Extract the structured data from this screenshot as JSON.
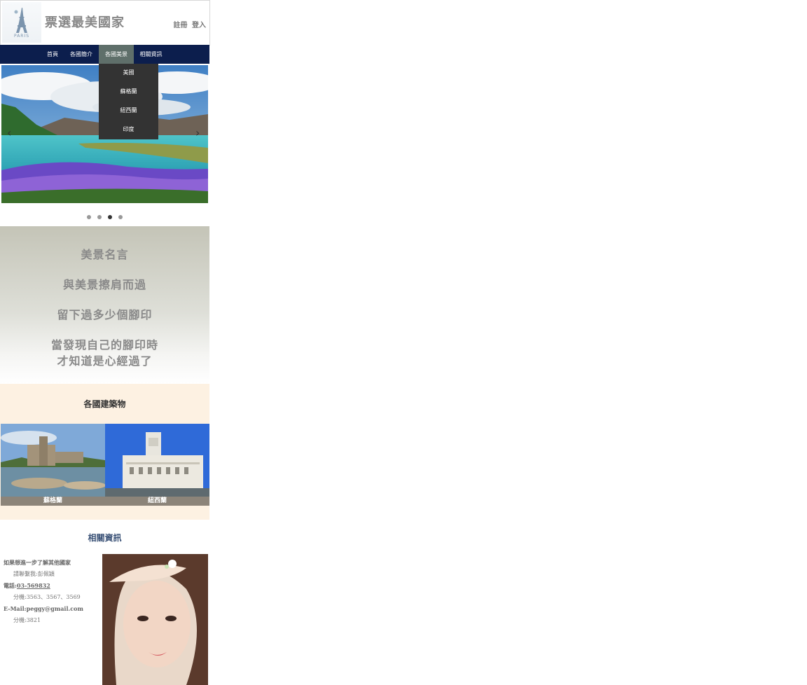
{
  "header": {
    "logo_text": "PARIS",
    "title": "票選最美國家",
    "register": "註冊",
    "login": "登入"
  },
  "nav": {
    "items": [
      "首頁",
      "各國簡介",
      "各國美景",
      "相關資訊"
    ],
    "active_index": 2,
    "dropdown": [
      "美國",
      "蘇格蘭",
      "紐西蘭",
      "印度"
    ]
  },
  "slider": {
    "prev_icon": "chevron-left-icon",
    "next_icon": "chevron-right-icon",
    "slide_count": 4,
    "active_slide": 3
  },
  "quote": {
    "lines": [
      "美景名言",
      "與美景擦肩而過",
      "留下過多少個腳印",
      "當發現自己的腳印時",
      "才知道是心經過了"
    ]
  },
  "buildings": {
    "title": "各國建築物",
    "items": [
      {
        "caption": "蘇格蘭"
      },
      {
        "caption": "紐西蘭"
      }
    ]
  },
  "info": {
    "title": "相關資訊",
    "line1": "如果想進一步了解其他國家",
    "line2": "請聯繫我:彭佩穎",
    "phone_label": "電話:",
    "phone": "03-569832",
    "ext1": "分機:3563、3567、3569",
    "email_label": "E-Mail:",
    "email": "peggy@gmail.com",
    "ext2": "分機:3821"
  },
  "colors": {
    "nav_bg": "#0c1e4d",
    "nav_active": "#5f6f6a",
    "dropdown_bg": "#333333",
    "buildings_bg": "#fdf1e2",
    "info_title": "#3b5277"
  }
}
